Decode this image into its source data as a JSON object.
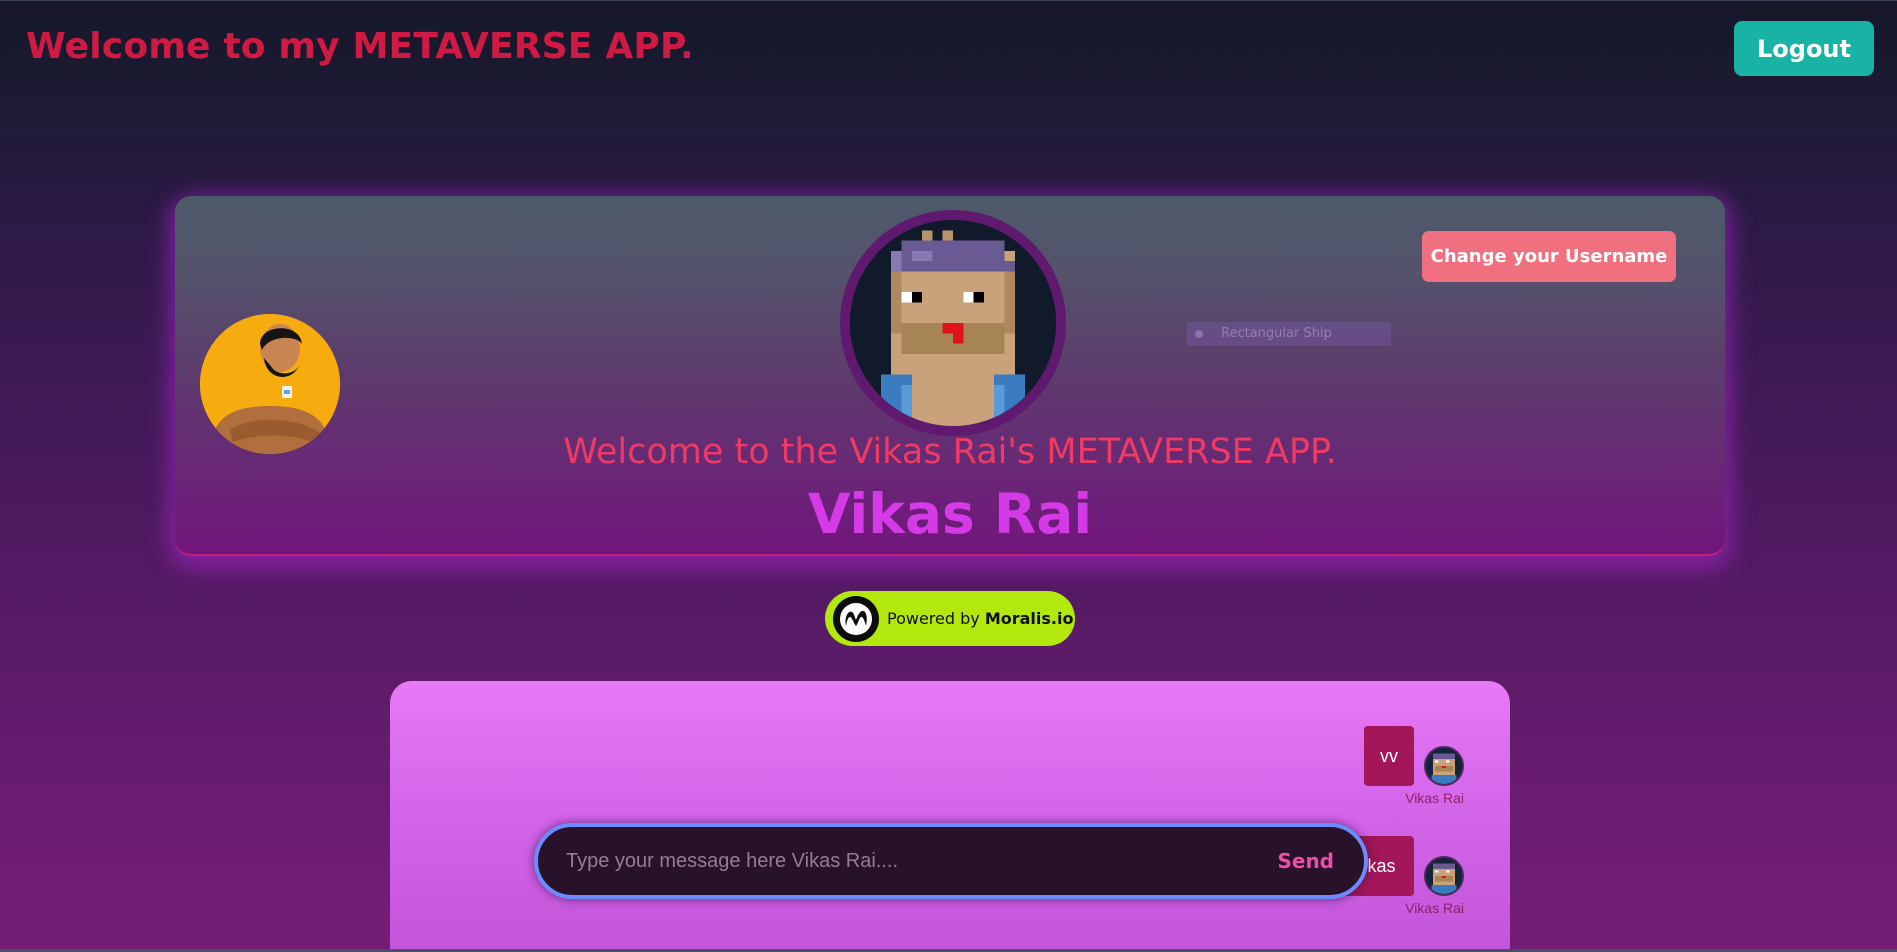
{
  "header": {
    "app_title": "Welcome to my METAVERSE APP.",
    "logout_label": "Logout"
  },
  "profile": {
    "change_username_label": "Change your Username",
    "hidden_select_text": "Rectangular Ship",
    "welcome_text": "Welcome to the Vikas Rai's METAVERSE APP.",
    "username": "Vikas Rai"
  },
  "badge": {
    "prefix": "Powered by",
    "brand": "Moralis.io"
  },
  "chat": {
    "messages": [
      {
        "text": "vv",
        "author": "Vikas Rai"
      },
      {
        "text": "vikas",
        "author": "Vikas Rai"
      }
    ],
    "input": {
      "placeholder": "Type your message here Vikas Rai....",
      "value": ""
    },
    "send_label": "Send"
  },
  "colors": {
    "title_red": "#d11a43",
    "logout_teal": "#19b3a6",
    "username_purple": "#d43be7",
    "welcome_pink": "#ee3a64",
    "change_btn": "#f0707f",
    "badge_lime": "#b3e80f",
    "chat_panel": "#e87af7",
    "bubble": "#a3165a"
  }
}
